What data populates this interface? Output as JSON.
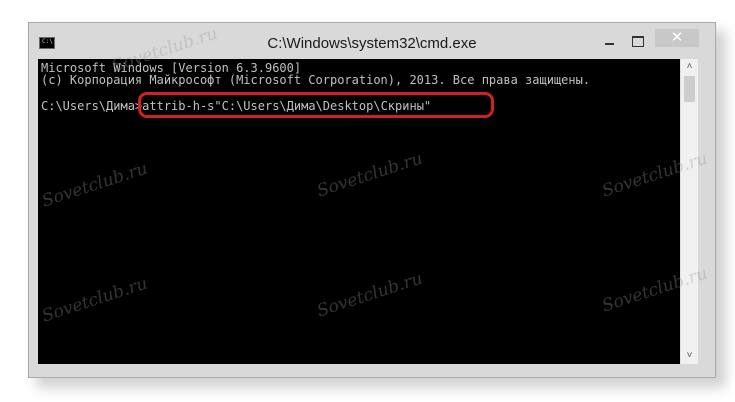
{
  "window": {
    "title": "C:\\Windows\\system32\\cmd.exe",
    "icon_glyph": "C:\\",
    "close_glyph": "✕"
  },
  "console": {
    "line1": "Microsoft Windows [Version 6.3.9600]",
    "line2": "(c) Корпорация Майкрософт (Microsoft Corporation), 2013. Все права защищены.",
    "prompt": "C:\\Users\\Дима>",
    "command": "attrib-h-s\"C:\\Users\\Дима\\Desktop\\Скрины\""
  },
  "scrollbar": {
    "up_glyph": "˄",
    "down_glyph": "˅"
  },
  "watermark": "Sovetclub.ru",
  "colors": {
    "highlight": "#d0202a",
    "console_bg": "#000000",
    "console_text": "#c0c0c0"
  }
}
